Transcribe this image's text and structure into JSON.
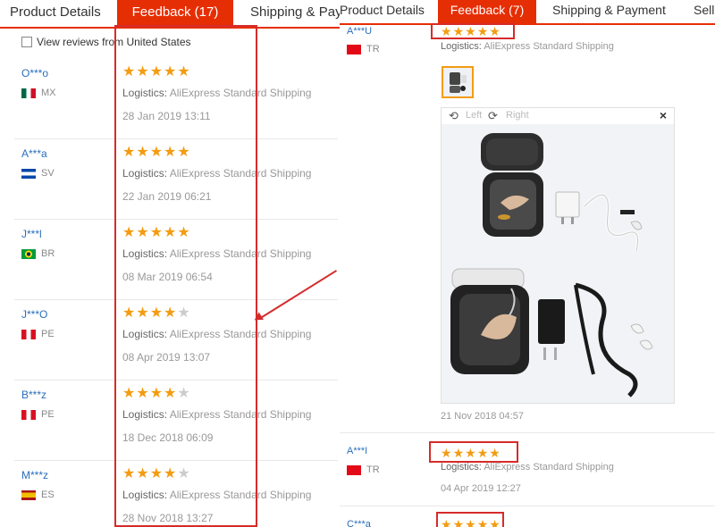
{
  "left": {
    "tabs": [
      {
        "label": "Product Details",
        "active": false
      },
      {
        "label": "Feedback (17)",
        "active": true
      },
      {
        "label": "Shipping & Payment",
        "active": false
      }
    ],
    "filter_label": "View reviews from United States",
    "reviews": [
      {
        "user": "O***o",
        "country": "MX",
        "stars": 5,
        "logistics_label": "Logistics:",
        "logistics": "AliExpress Standard Shipping",
        "date": "28 Jan 2019 13:11"
      },
      {
        "user": "A***a",
        "country": "SV",
        "stars": 5,
        "logistics_label": "Logistics:",
        "logistics": "AliExpress Standard Shipping",
        "date": "22 Jan 2019 06:21"
      },
      {
        "user": "J***l",
        "country": "BR",
        "stars": 5,
        "logistics_label": "Logistics:",
        "logistics": "AliExpress Standard Shipping",
        "date": "08 Mar 2019 06:54"
      },
      {
        "user": "J***O",
        "country": "PE",
        "stars": 4,
        "logistics_label": "Logistics:",
        "logistics": "AliExpress Standard Shipping",
        "date": "08 Apr 2019 13:07"
      },
      {
        "user": "B***z",
        "country": "PE",
        "stars": 4,
        "logistics_label": "Logistics:",
        "logistics": "AliExpress Standard Shipping",
        "date": "18 Dec 2018 06:09"
      },
      {
        "user": "M***z",
        "country": "ES",
        "stars": 4,
        "logistics_label": "Logistics:",
        "logistics": "AliExpress Standard Shipping",
        "date": "28 Nov 2018 13:27"
      }
    ]
  },
  "right": {
    "tabs": [
      {
        "label": "Product Details",
        "active": false
      },
      {
        "label": "Feedback (7)",
        "active": true
      },
      {
        "label": "Shipping & Payment",
        "active": false
      },
      {
        "label": "Selle",
        "active": false
      }
    ],
    "viewer": {
      "left_label": "Left",
      "right_label": "Right",
      "close_label": "×"
    },
    "reviews": [
      {
        "user": "A***U",
        "country": "TR",
        "stars": 5,
        "logistics_label": "Logistics:",
        "logistics": "AliExpress Standard Shipping",
        "date": "21 Nov 2018 04:57"
      },
      {
        "user": "A***I",
        "country": "TR",
        "stars": 5,
        "logistics_label": "Logistics:",
        "logistics": "AliExpress Standard Shipping",
        "date": "04 Apr 2019 12:27"
      },
      {
        "user": "C***a",
        "country": "",
        "stars": 5
      }
    ]
  },
  "colors": {
    "accent": "#e62e04",
    "star": "#f39c12",
    "highlight": "#d62b2b",
    "link": "#2a6ebb"
  },
  "icons": {
    "rotate_left": "rotate-left-icon",
    "rotate_right": "rotate-right-icon",
    "close": "close-icon",
    "star": "star-icon",
    "checkbox": "checkbox-icon"
  }
}
